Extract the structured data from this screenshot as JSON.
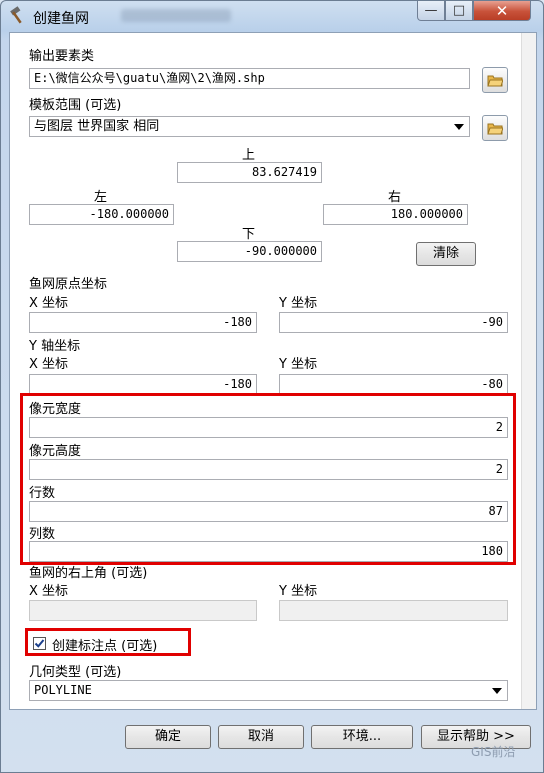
{
  "window": {
    "title": "创建鱼网"
  },
  "output_features": {
    "label": "输出要素类",
    "value": "E:\\微信公众号\\guatu\\渔网\\2\\渔网.shp"
  },
  "template_extent": {
    "label": "模板范围 (可选)",
    "selected": "与图层 世界国家 相同",
    "top_label": "上",
    "top_value": "83.627419",
    "left_label": "左",
    "left_value": "-180.000000",
    "right_label": "右",
    "right_value": "180.000000",
    "bottom_label": "下",
    "bottom_value": "-90.000000",
    "clear_label": "清除"
  },
  "origin": {
    "label": "鱼网原点坐标",
    "x_label": "X 坐标",
    "x_value": "-180",
    "y_label": "Y 坐标",
    "y_value": "-90"
  },
  "y_axis": {
    "label": "Y 轴坐标",
    "x_label": "X 坐标",
    "x_value": "-180",
    "y_label": "Y 坐标",
    "y_value": "-80"
  },
  "cells": {
    "width_label": "像元宽度",
    "width_value": "2",
    "height_label": "像元高度",
    "height_value": "2",
    "rows_label": "行数",
    "rows_value": "87",
    "cols_label": "列数",
    "cols_value": "180"
  },
  "opposite_corner": {
    "label": "鱼网的右上角 (可选)",
    "x_label": "X 坐标",
    "x_value": "",
    "y_label": "Y 坐标",
    "y_value": ""
  },
  "labels_option": {
    "label": "创建标注点 (可选)",
    "checked": true
  },
  "geometry": {
    "label": "几何类型 (可选)",
    "selected": "POLYLINE"
  },
  "buttons": {
    "ok": "确定",
    "cancel": "取消",
    "env": "环境...",
    "help": "显示帮助 >>"
  },
  "watermark": {
    "brand": "GIS前沿"
  },
  "colors": {
    "highlight": "#e00000",
    "window_frame": "#b9d0ea"
  }
}
